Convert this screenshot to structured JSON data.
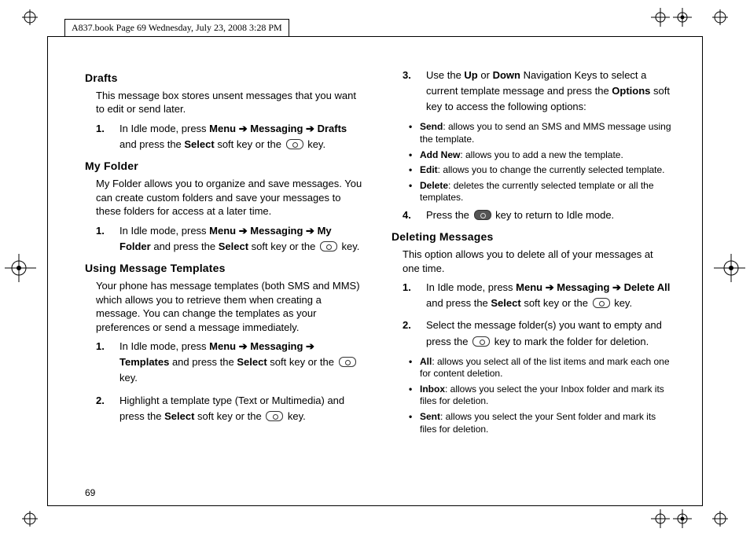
{
  "header": "A837.book  Page 69  Wednesday, July 23, 2008  3:28 PM",
  "page_number": "69",
  "left": {
    "drafts_h": "Drafts",
    "drafts_p": "This message box stores unsent messages that you want to edit or send later.",
    "drafts_1a": "In Idle mode, press ",
    "drafts_1_menu": "Menu",
    "drafts_1_msg": "Messaging",
    "drafts_1_drafts": "Drafts",
    "drafts_1b": " and press the ",
    "drafts_1_select": "Select",
    "drafts_1c": " soft key or the ",
    "drafts_1d": " key.",
    "myfolder_h": "My Folder",
    "myfolder_p": "My Folder allows you to organize and save messages. You can create custom folders and save your messages to these folders for access at a later time.",
    "myfolder_1a": "In Idle mode, press ",
    "myfolder_1_menu": "Menu",
    "myfolder_1_msg": "Messaging",
    "myfolder_1_mf": "My Folder",
    "myfolder_1b": " and press the ",
    "myfolder_1_select": "Select",
    "myfolder_1c": " soft key or the ",
    "myfolder_1d": " key.",
    "templates_h": "Using Message Templates",
    "templates_p": "Your phone has message templates (both SMS and MMS) which allows you to retrieve them when creating a message. You can change the templates as your preferences or send a message immediately.",
    "templates_1a": "In Idle mode, press ",
    "templates_1_menu": "Menu",
    "templates_1_msg": "Messaging",
    "templates_1_tpl": "Templates",
    "templates_1b": " and press the ",
    "templates_1_select": "Select",
    "templates_1c": " soft key or the ",
    "templates_1d": " key.",
    "templates_2a": "Highlight a template type (Text or Multimedia) and press the ",
    "templates_2_select": "Select",
    "templates_2b": " soft key or the ",
    "templates_2c": " key."
  },
  "right": {
    "step3a": "Use the ",
    "step3_up": "Up",
    "step3_or": " or ",
    "step3_down": "Down",
    "step3b": " Navigation Keys to select a current template message and press the ",
    "step3_options": "Options",
    "step3c": " soft key to access the following options:",
    "bul_send_b": "Send",
    "bul_send": ": allows you to send an SMS and MMS message using the template.",
    "bul_add_b": "Add New",
    "bul_add": ": allows you to add a new the template.",
    "bul_edit_b": "Edit",
    "bul_edit": ": allows you to change the currently selected template.",
    "bul_del_b": "Delete",
    "bul_del": ": deletes the currently selected template or all the templates.",
    "step4a": "Press the ",
    "step4b": " key to return to Idle mode.",
    "delmsg_h": "Deleting Messages",
    "delmsg_p": "This option allows you to delete all of your messages at one time.",
    "del_1a": "In Idle mode, press ",
    "del_1_menu": "Menu",
    "del_1_msg": "Messaging",
    "del_1_da": "Delete All",
    "del_1b": " and press the ",
    "del_1_select": "Select",
    "del_1c": " soft key or the ",
    "del_1d": " key.",
    "del_2a": "Select the message folder(s) you want to empty and press the ",
    "del_2b": " key to mark the folder for deletion.",
    "bul_all_b": "All",
    "bul_all": ": allows you select all of the list items and mark each one for content deletion.",
    "bul_inbox_b": "Inbox",
    "bul_inbox": ": allows you select the your Inbox folder and mark its files for deletion.",
    "bul_sent_b": "Sent",
    "bul_sent": ": allows you select the your Sent folder and mark its files for deletion."
  },
  "arrow": " ➔ "
}
